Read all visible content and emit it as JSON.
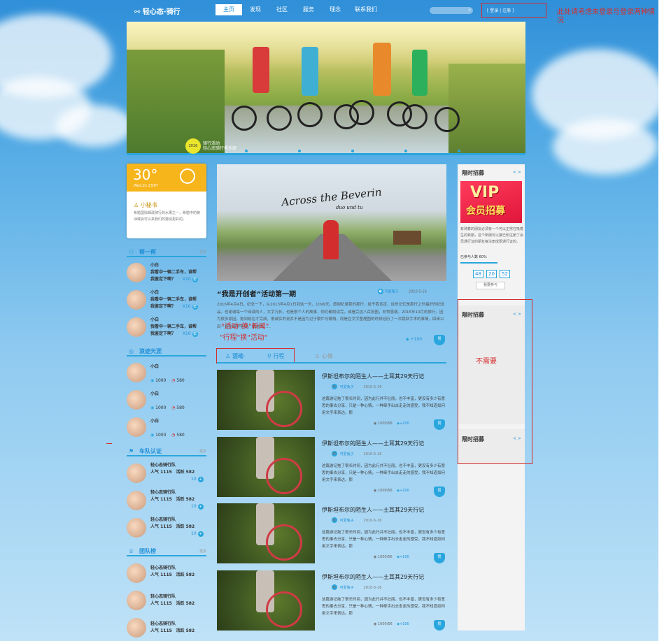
{
  "header": {
    "logo": "轻心态·骑行",
    "nav": [
      "主页",
      "发现",
      "社区",
      "服务",
      "理念",
      "联系我们"
    ],
    "login": "[ 登录 | 注册 ]"
  },
  "annotations": {
    "login_note": "此处请考虑未登录与登录两种情况",
    "tab_note_1": "\"活动\"换\"新闻\"",
    "tab_note_2": "\"行程\"换\"活动\"",
    "right_note": "不需要"
  },
  "hero": {
    "badge": "2016",
    "caption_1": "骑行活动",
    "caption_2": "轻心态骑行俱乐部"
  },
  "weather": {
    "temp": "30°",
    "date": "Wed.Zn  23/07",
    "tip_title": "小秘书",
    "tip_desc": "希腊国际邮政骑行的水果之一，希腊中的黄油或会可以来我们的邀请更彩的。"
  },
  "help": {
    "title": "帮一帮",
    "more": "更多",
    "items": [
      {
        "name": "小白",
        "line1": "我看中一辆二手车，谁帮",
        "line2": "我鉴定下啊？",
        "reward": "X10"
      },
      {
        "name": "小白",
        "line1": "我看中一辆二手车，谁帮",
        "line2": "我鉴定下啊？",
        "reward": "X10"
      },
      {
        "name": "小白",
        "line1": "我看中一辆二手车，谁帮",
        "line2": "我鉴定下啊？",
        "reward": "X10"
      }
    ]
  },
  "wander": {
    "title": "浪迹天涯",
    "items": [
      {
        "name": "小白",
        "a": "1000",
        "b": "580"
      },
      {
        "name": "小白",
        "a": "1000",
        "b": "580"
      },
      {
        "name": "小白",
        "a": "1000",
        "b": "580"
      }
    ]
  },
  "team_cert": {
    "title": "车队认证",
    "more": "更多",
    "items": [
      {
        "name": "轻心态骑行队",
        "pop": "人气 1115",
        "active": "活跃 582",
        "num": "10"
      },
      {
        "name": "轻心态骑行队",
        "pop": "人气 1115",
        "active": "活跃 582",
        "num": "10"
      },
      {
        "name": "轻心态骑行队",
        "pop": "人气 1115",
        "active": "活跃 582",
        "num": "10"
      }
    ]
  },
  "team_rank": {
    "title": "团队榜",
    "more": "更多",
    "items": [
      {
        "name": "轻心态骑行队",
        "pop": "人气 1115",
        "active": "活跃 582"
      },
      {
        "name": "轻心态骑行队",
        "pop": "人气 1115",
        "active": "活跃 582"
      },
      {
        "name": "轻心态骑行队",
        "pop": "人气 1115",
        "active": "活跃 582"
      }
    ]
  },
  "feature": {
    "image_text_1": "Across the Beverin",
    "image_text_2": "duo und tu",
    "title": "“我是开创者”活动第一期",
    "author": "可爱兔子",
    "date": "2010-5-16",
    "desc": "2016年4月4日，纪念一下，从2013年4月1日到这一天，1099天，感谢纪录我的那行，给予我肯定，这份记忆是那行之外最好的纪念品。也谢谢每一个阅读的人，文字冗长，也是很个人的故事，你们都耐读完，或看完这八百张图，非常感谢。2015年10月的旅行，因为很多原因，拖到现在才完成，很诚实的说并不是因为过于繁忙与懒惰，而是在文字整理图的时候经历了一次跳跃手术的事情，回来以后一直在修养身体。幸运的……",
    "likes": "+100",
    "heart_label": "赞"
  },
  "tabs": [
    "活动",
    "行程",
    "心情"
  ],
  "posts": [
    {
      "title": "伊斯坦布尔的陌生人——土耳其29天行记",
      "author": "可爱兔子",
      "date": "2010-5-16",
      "desc": "这篇游记拖了很长时间，因为此行并不壮丽，也不丰富，更没有多少有意思的事去分享，只是一种心情，一种牵手出去走走的感受，我不知道如何用文字来表达。那",
      "views": "1000/56",
      "likes": "+100",
      "heart": "赞"
    },
    {
      "title": "伊斯坦布尔的陌生人——土耳其29天行记",
      "author": "可爱兔子",
      "date": "2010-5-16",
      "desc": "这篇游记拖了很长时间，因为此行并不壮丽，也不丰富，更没有多少有意思的事去分享，只是一种心情，一种牵手出去走走的感受，我不知道如何用文字来表达。那",
      "views": "1000/56",
      "likes": "+100",
      "heart": "赞"
    },
    {
      "title": "伊斯坦布尔的陌生人——土耳其29天行记",
      "author": "可爱兔子",
      "date": "2010-5-16",
      "desc": "这篇游记拖了很长时间，因为此行并不壮丽，也不丰富，更没有多少有意思的事去分享，只是一种心情，一种牵手出去走走的感受，我不知道如何用文字来表达。那",
      "views": "1000/56",
      "likes": "+100",
      "heart": "赞"
    },
    {
      "title": "伊斯坦布尔的陌生人——土耳其29天行记",
      "author": "可爱兔子",
      "date": "2010-5-16",
      "desc": "这篇游记拖了很长时间，因为此行并不壮丽，也不丰富，更没有多少有意思的事去分享，只是一种心情，一种牵手出去走走的感受，我不知道如何用文字来表达。那",
      "views": "1000/56",
      "likes": "+100",
      "heart": "赞"
    }
  ],
  "recruit": {
    "title": "限时招募",
    "arrows": "< >",
    "vip_text": "VIP",
    "vip_sub": "会员招募",
    "desc": "有骑着的朋友必须有一个可以正常在吸着生的新朋，这个新朋可以接已知注册了会员通行证的朋友每注册成限通行证的。",
    "progress": "已参与人数 60%",
    "progress_value": 0.6,
    "timer": [
      "48",
      "20",
      "52"
    ],
    "join": "我要参与"
  },
  "colors": {
    "accent": "#2aa6de",
    "annotation": "#d42d2d",
    "weather": "#f7b51c"
  }
}
